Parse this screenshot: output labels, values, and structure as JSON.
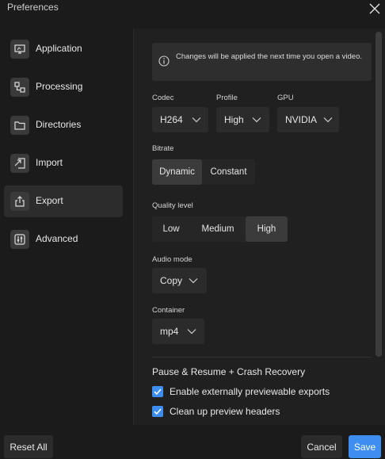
{
  "window": {
    "title": "Preferences"
  },
  "sidebar": {
    "items": [
      {
        "label": "Application",
        "icon": "application-icon"
      },
      {
        "label": "Processing",
        "icon": "processing-icon"
      },
      {
        "label": "Directories",
        "icon": "folder-icon"
      },
      {
        "label": "Import",
        "icon": "import-icon"
      },
      {
        "label": "Export",
        "icon": "export-icon",
        "active": true
      },
      {
        "label": "Advanced",
        "icon": "advanced-icon"
      }
    ]
  },
  "export": {
    "info": "Changes will be applied the next time you open a video.",
    "codec": {
      "label": "Codec",
      "value": "H264"
    },
    "profile": {
      "label": "Profile",
      "value": "High"
    },
    "gpu": {
      "label": "GPU",
      "value": "NVIDIA"
    },
    "bitrate": {
      "label": "Bitrate",
      "options": [
        "Dynamic",
        "Constant"
      ],
      "selected": "Dynamic"
    },
    "quality": {
      "label": "Quality level",
      "options": [
        "Low",
        "Medium",
        "High"
      ],
      "selected": "High"
    },
    "audio_mode": {
      "label": "Audio mode",
      "value": "Copy"
    },
    "container": {
      "label": "Container",
      "value": "mp4"
    },
    "section_title": "Pause & Resume + Crash Recovery",
    "checks": [
      {
        "label": "Enable externally previewable exports",
        "checked": true
      },
      {
        "label": "Clean up preview headers",
        "checked": true
      }
    ]
  },
  "footer": {
    "reset_label": "Reset All",
    "cancel_label": "Cancel",
    "save_label": "Save"
  },
  "colors": {
    "accent": "#3d8eef",
    "background": "#1b1b1b",
    "panel": "#202020"
  }
}
